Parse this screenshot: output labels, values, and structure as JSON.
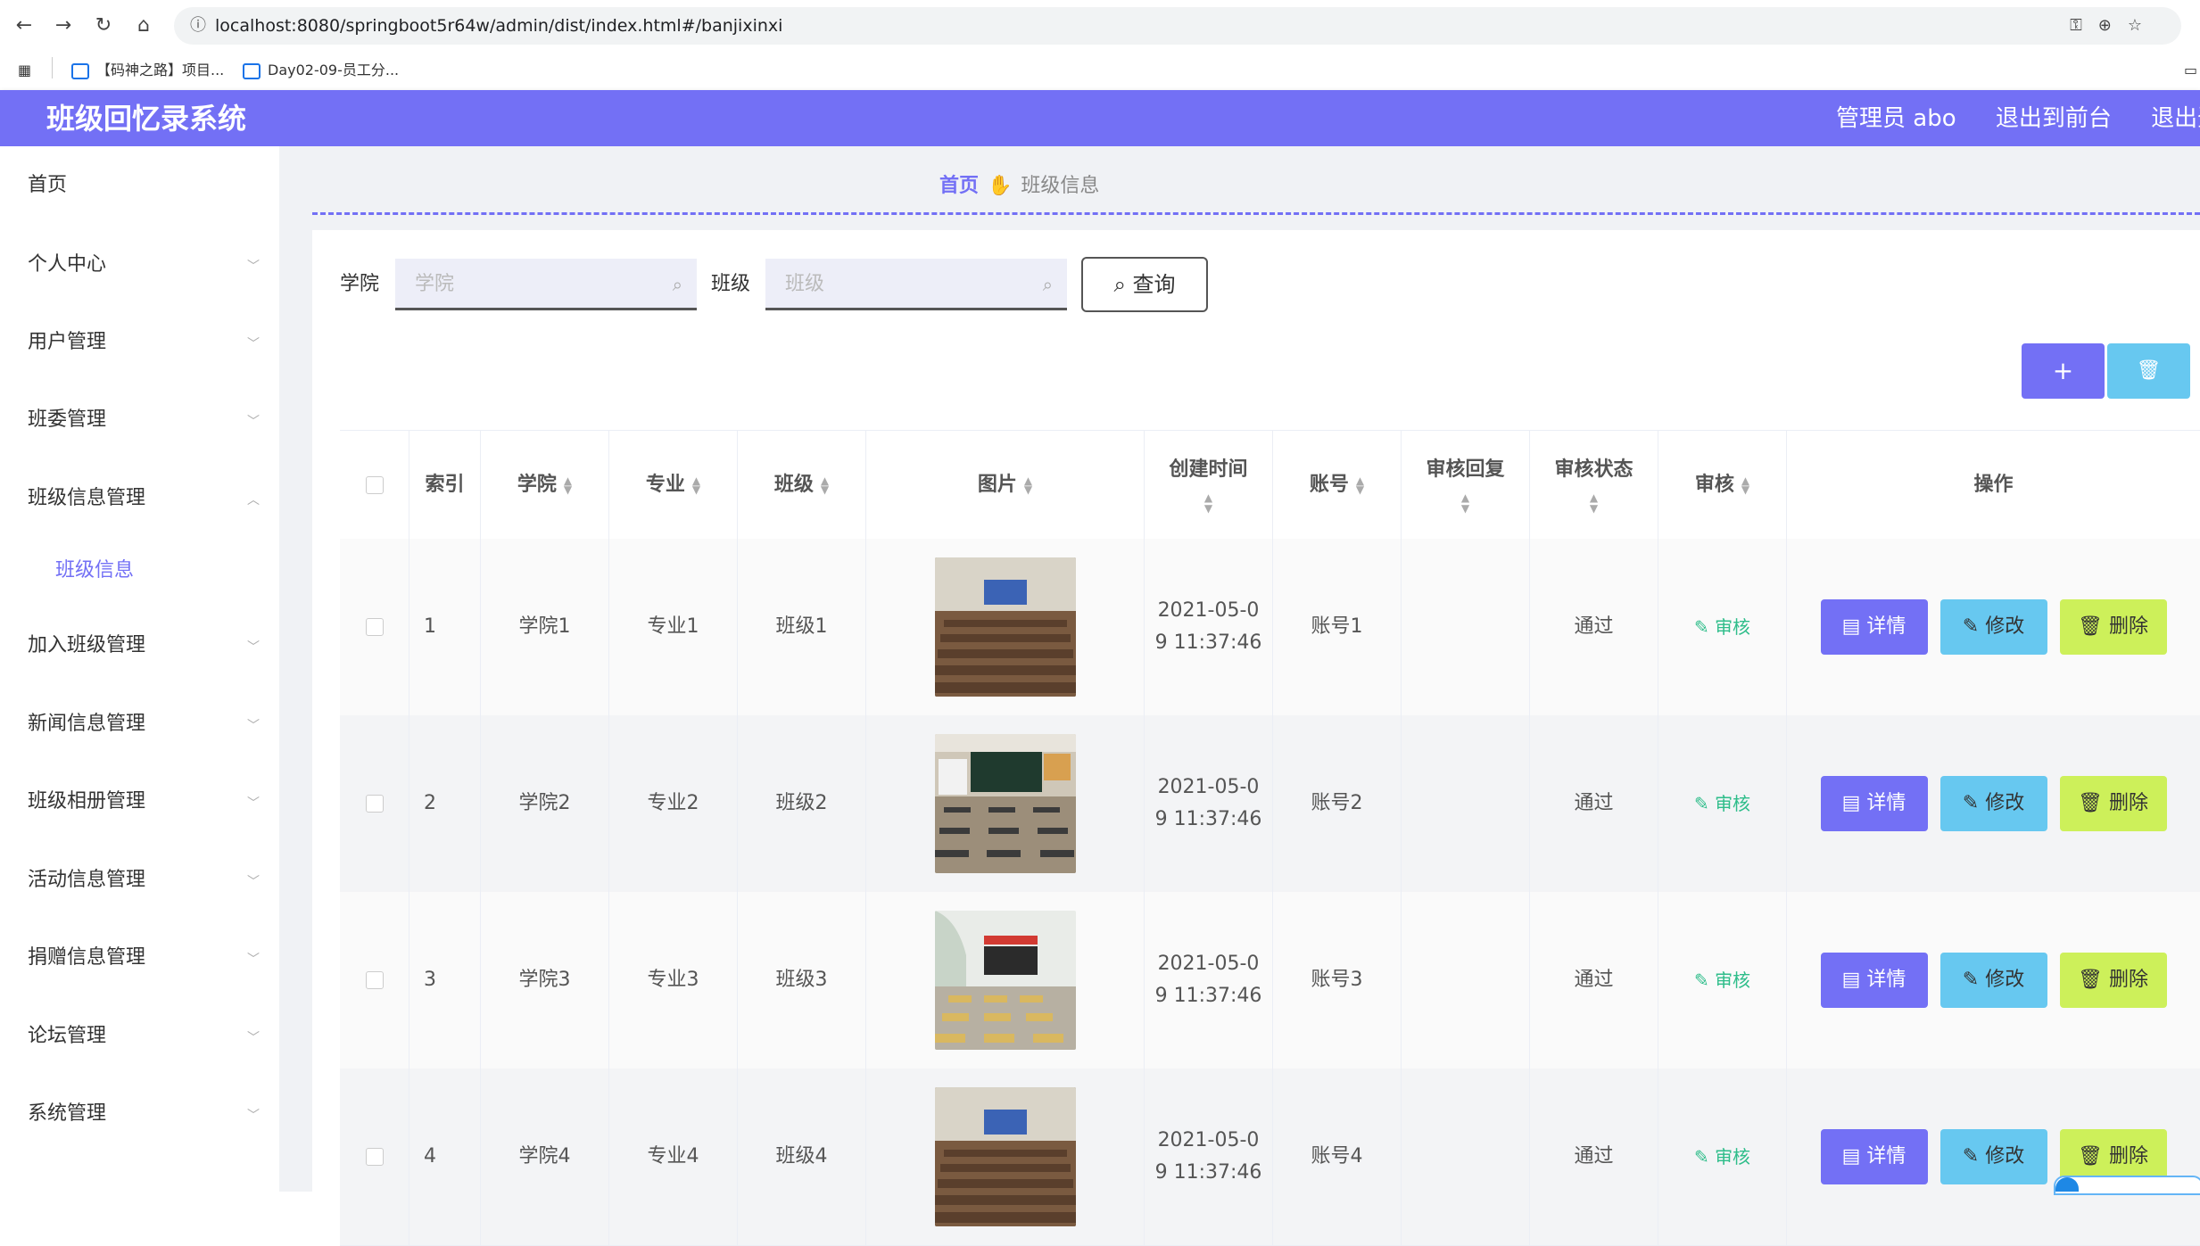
{
  "browser": {
    "url": "localhost:8080/springboot5r64w/admin/dist/index.html#/banjixinxi",
    "bookmarks": [
      "【码神之路】项目...",
      "Day02-09-员工分..."
    ]
  },
  "header": {
    "title": "班级回忆录系统",
    "user": "管理员 abo",
    "to_front": "退出到前台",
    "logout": "退出登"
  },
  "sidebar": {
    "items": [
      "首页",
      "个人中心",
      "用户管理",
      "班委管理",
      "班级信息管理",
      "加入班级管理",
      "新闻信息管理",
      "班级相册管理",
      "活动信息管理",
      "捐赠信息管理",
      "论坛管理",
      "系统管理"
    ],
    "active_sub": "班级信息"
  },
  "breadcrumb": {
    "home": "首页",
    "current": "班级信息"
  },
  "search": {
    "college_label": "学院",
    "college_placeholder": "学院",
    "class_label": "班级",
    "class_placeholder": "班级",
    "query_label": "查询"
  },
  "toolbar": {
    "add_label": "+",
    "delete_label": "🗑"
  },
  "table": {
    "headers": {
      "index": "索引",
      "college": "学院",
      "major": "专业",
      "class": "班级",
      "image": "图片",
      "created": "创建时间",
      "account": "账号",
      "reply": "审核回复",
      "status": "审核状态",
      "audit": "审核",
      "ops": "操作"
    },
    "rows": [
      {
        "index": "1",
        "college": "学院1",
        "major": "专业1",
        "class": "班级1",
        "created_1": "2021-05-0",
        "created_2": "9 11:37:46",
        "account": "账号1",
        "reply": "",
        "status": "通过",
        "audit": "审核"
      },
      {
        "index": "2",
        "college": "学院2",
        "major": "专业2",
        "class": "班级2",
        "created_1": "2021-05-0",
        "created_2": "9 11:37:46",
        "account": "账号2",
        "reply": "",
        "status": "通过",
        "audit": "审核"
      },
      {
        "index": "3",
        "college": "学院3",
        "major": "专业3",
        "class": "班级3",
        "created_1": "2021-05-0",
        "created_2": "9 11:37:46",
        "account": "账号3",
        "reply": "",
        "status": "通过",
        "audit": "审核"
      },
      {
        "index": "4",
        "college": "学院4",
        "major": "专业4",
        "class": "班级4",
        "created_1": "2021-05-0",
        "created_2": "9 11:37:46",
        "account": "账号4",
        "reply": "",
        "status": "通过",
        "audit": "审核"
      }
    ],
    "ops": {
      "detail": "详情",
      "edit": "修改",
      "delete": "删除"
    }
  },
  "colors": {
    "primary": "#7370f5",
    "cyan": "#67c8f0",
    "lime": "#cdf05a",
    "green": "#2ebd8a"
  }
}
